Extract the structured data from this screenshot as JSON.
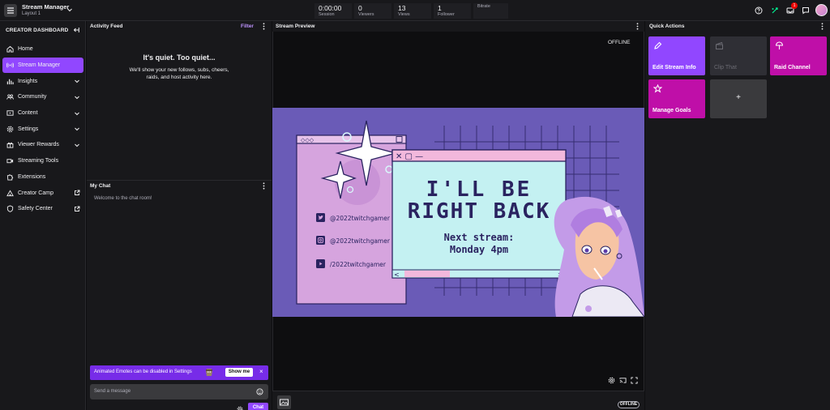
{
  "topbar": {
    "title": "Stream Manager",
    "subtitle": "Layout 1",
    "stats": [
      {
        "value": "0:00:00",
        "label": "Session"
      },
      {
        "value": "0",
        "label": "Viewers"
      },
      {
        "value": "13",
        "label": "Views"
      },
      {
        "value": "1",
        "label": "Follower"
      },
      {
        "value": "",
        "label": "Bitrate"
      }
    ],
    "notification_count": "1"
  },
  "sidebar": {
    "heading": "CREATOR DASHBOARD",
    "items": [
      {
        "label": "Home",
        "icon": "home-icon"
      },
      {
        "label": "Stream Manager",
        "icon": "broadcast-icon",
        "active": true
      },
      {
        "label": "Insights",
        "icon": "insights-icon",
        "expandable": true
      },
      {
        "label": "Community",
        "icon": "community-icon",
        "expandable": true
      },
      {
        "label": "Content",
        "icon": "content-icon",
        "expandable": true
      },
      {
        "label": "Settings",
        "icon": "gear-icon",
        "expandable": true
      },
      {
        "label": "Viewer Rewards",
        "icon": "rewards-icon",
        "expandable": true
      },
      {
        "label": "Streaming Tools",
        "icon": "camera-icon"
      },
      {
        "label": "Extensions",
        "icon": "extensions-icon"
      },
      {
        "label": "Creator Camp",
        "icon": "creator-camp-icon",
        "external": true
      },
      {
        "label": "Safety Center",
        "icon": "shield-icon",
        "external": true
      }
    ]
  },
  "activity_feed": {
    "title": "Activity Feed",
    "filter_label": "Filter",
    "empty_title": "It's quiet. Too quiet...",
    "empty_desc": "We'll show your new follows, subs, cheers, raids, and host activity here."
  },
  "chat": {
    "title": "My Chat",
    "welcome": "Welcome to the chat room!",
    "emote_notice": "Animated Emotes can be disabled in Settings",
    "show_me": "Show me",
    "placeholder": "Send a message",
    "send_label": "Chat"
  },
  "preview": {
    "title": "Stream Preview",
    "status": "OFFLINE",
    "footer_status": "OFFLINE",
    "brb_line1": "I'LL BE",
    "brb_line2": "RIGHT BACK",
    "next1": "Next stream:",
    "next2": "Monday 4pm",
    "socials": [
      "@2022twitchgamer",
      "@2022twitchgamer",
      "/2022twitchgamer"
    ]
  },
  "quick_actions": {
    "title": "Quick Actions",
    "tiles": [
      {
        "label": "Edit Stream Info",
        "color": "#9147ff",
        "icon": "pencil-icon"
      },
      {
        "label": "Clip That",
        "color": "#2f2f35",
        "icon": "clip-icon",
        "disabled": true
      },
      {
        "label": "Raid Channel",
        "color": "#bf0fa8",
        "icon": "raid-icon"
      },
      {
        "label": "Manage Goals",
        "color": "#bf0fa8",
        "icon": "star-icon"
      },
      {
        "label": "+",
        "color": "#3a3a3d",
        "icon": "plus-icon"
      }
    ]
  }
}
